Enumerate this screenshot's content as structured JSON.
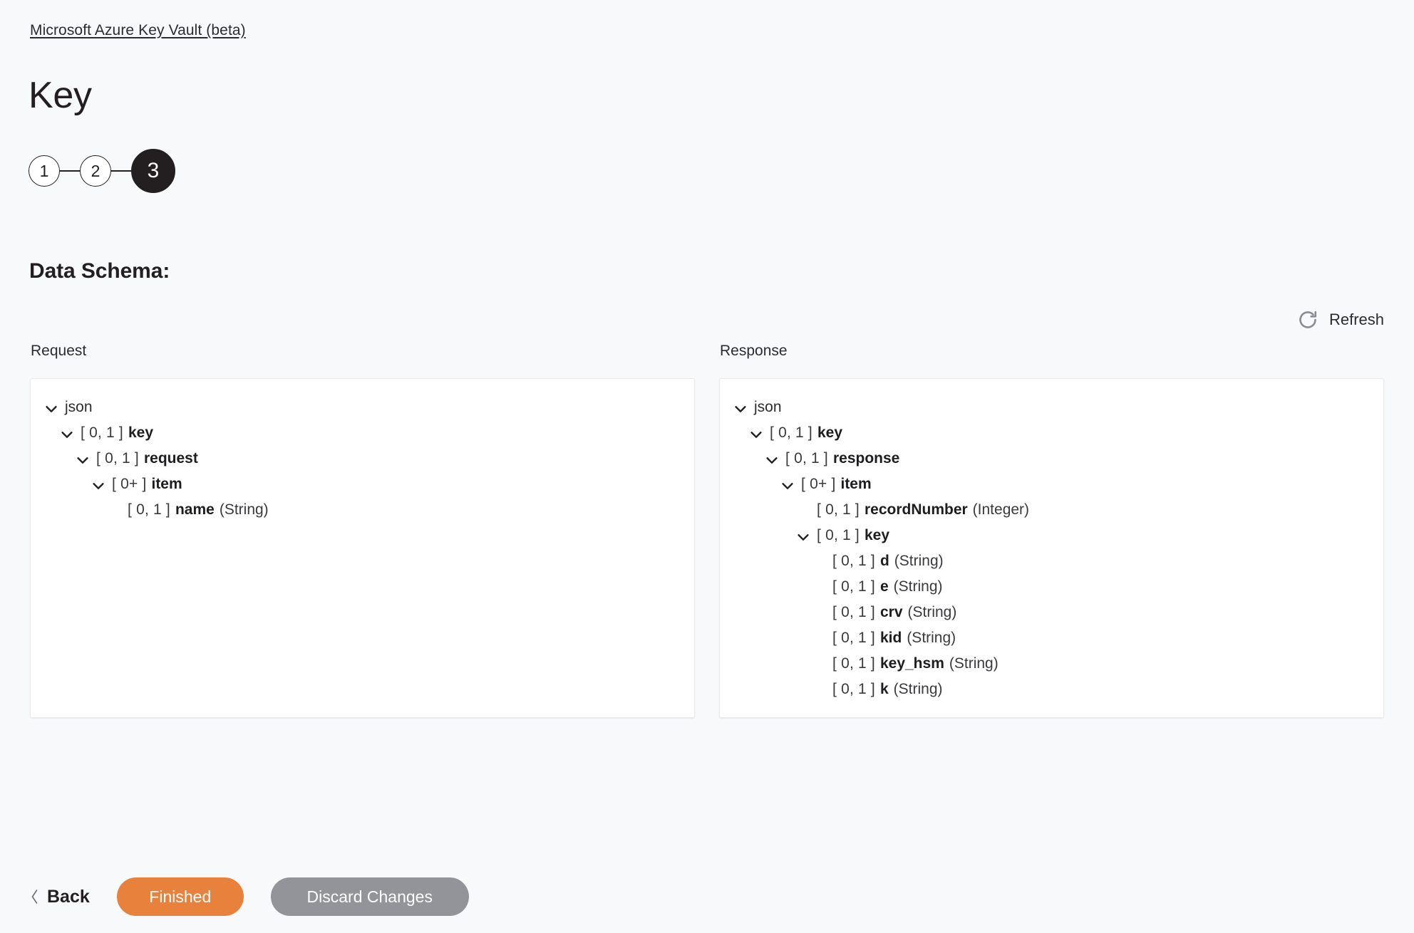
{
  "breadcrumb": {
    "label": "Microsoft Azure Key Vault (beta)"
  },
  "page": {
    "title": "Key",
    "section_heading": "Data Schema:"
  },
  "stepper": {
    "steps": [
      {
        "label": "1",
        "state": "inactive"
      },
      {
        "label": "2",
        "state": "inactive"
      },
      {
        "label": "3",
        "state": "active"
      }
    ]
  },
  "toolbar": {
    "refresh_label": "Refresh",
    "refresh_icon": "refresh-icon"
  },
  "schema": {
    "request": {
      "label": "Request",
      "nodes": [
        {
          "depth": 0,
          "chevron": "chevron-down-icon",
          "cardinality": "",
          "name": "json",
          "type": "",
          "bold": false
        },
        {
          "depth": 1,
          "chevron": "chevron-down-icon",
          "cardinality": "[ 0, 1 ]",
          "name": "key",
          "type": "",
          "bold": true
        },
        {
          "depth": 2,
          "chevron": "chevron-down-icon",
          "cardinality": "[ 0, 1 ]",
          "name": "request",
          "type": "",
          "bold": true
        },
        {
          "depth": 3,
          "chevron": "chevron-down-icon",
          "cardinality": "[ 0+ ]",
          "name": "item",
          "type": "",
          "bold": true
        },
        {
          "depth": 4,
          "chevron": "",
          "cardinality": "[ 0, 1 ]",
          "name": "name",
          "type": "(String)",
          "bold": true
        }
      ]
    },
    "response": {
      "label": "Response",
      "nodes": [
        {
          "depth": 0,
          "chevron": "chevron-down-icon",
          "cardinality": "",
          "name": "json",
          "type": "",
          "bold": false
        },
        {
          "depth": 1,
          "chevron": "chevron-down-icon",
          "cardinality": "[ 0, 1 ]",
          "name": "key",
          "type": "",
          "bold": true
        },
        {
          "depth": 2,
          "chevron": "chevron-down-icon",
          "cardinality": "[ 0, 1 ]",
          "name": "response",
          "type": "",
          "bold": true
        },
        {
          "depth": 3,
          "chevron": "chevron-down-icon",
          "cardinality": "[ 0+ ]",
          "name": "item",
          "type": "",
          "bold": true
        },
        {
          "depth": 4,
          "chevron": "",
          "cardinality": "[ 0, 1 ]",
          "name": "recordNumber",
          "type": "(Integer)",
          "bold": true
        },
        {
          "depth": 4,
          "chevron": "chevron-down-icon",
          "cardinality": "[ 0, 1 ]",
          "name": "key",
          "type": "",
          "bold": true
        },
        {
          "depth": 5,
          "chevron": "",
          "cardinality": "[ 0, 1 ]",
          "name": "d",
          "type": "(String)",
          "bold": true
        },
        {
          "depth": 5,
          "chevron": "",
          "cardinality": "[ 0, 1 ]",
          "name": "e",
          "type": "(String)",
          "bold": true
        },
        {
          "depth": 5,
          "chevron": "",
          "cardinality": "[ 0, 1 ]",
          "name": "crv",
          "type": "(String)",
          "bold": true
        },
        {
          "depth": 5,
          "chevron": "",
          "cardinality": "[ 0, 1 ]",
          "name": "kid",
          "type": "(String)",
          "bold": true
        },
        {
          "depth": 5,
          "chevron": "",
          "cardinality": "[ 0, 1 ]",
          "name": "key_hsm",
          "type": "(String)",
          "bold": true
        },
        {
          "depth": 5,
          "chevron": "",
          "cardinality": "[ 0, 1 ]",
          "name": "k",
          "type": "(String)",
          "bold": true
        }
      ]
    }
  },
  "footer": {
    "back_label": "Back",
    "back_icon": "chevron-left-icon",
    "finished_label": "Finished",
    "discard_label": "Discard Changes"
  },
  "colors": {
    "accent_primary": "#e8813b",
    "secondary": "#93939a",
    "step_active": "#231f20",
    "page_background": "#f8f9fb",
    "panel_background": "#ffffff"
  }
}
